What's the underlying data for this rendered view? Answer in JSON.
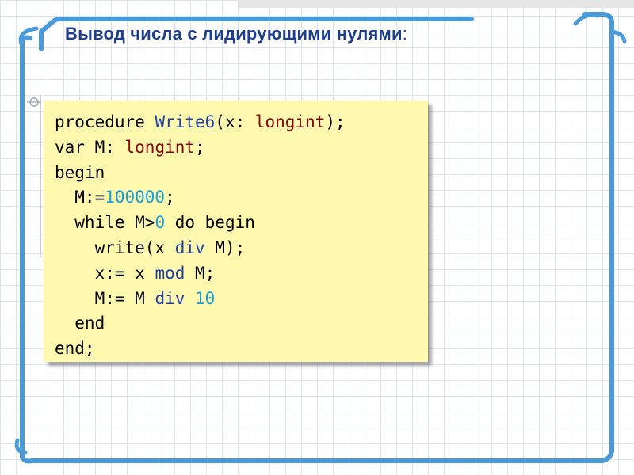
{
  "slide": {
    "title": "Вывод числа с лидирующими нулями",
    "title_colon": ":"
  },
  "code_lines": [
    [
      {
        "t": "procedure ",
        "c": "plain"
      },
      {
        "t": "Write6",
        "c": "blue"
      },
      {
        "t": "(x: ",
        "c": "plain"
      },
      {
        "t": "longint",
        "c": "red"
      },
      {
        "t": ");",
        "c": "plain"
      }
    ],
    [
      {
        "t": "var M: ",
        "c": "plain"
      },
      {
        "t": "longint",
        "c": "red"
      },
      {
        "t": ";",
        "c": "plain"
      }
    ],
    [
      {
        "t": "begin",
        "c": "plain"
      }
    ],
    [
      {
        "t": "  M:=",
        "c": "plain"
      },
      {
        "t": "100000",
        "c": "num"
      },
      {
        "t": ";",
        "c": "plain"
      }
    ],
    [
      {
        "t": "  while M>",
        "c": "plain"
      },
      {
        "t": "0",
        "c": "num"
      },
      {
        "t": " do begin",
        "c": "plain"
      }
    ],
    [
      {
        "t": "    write(x ",
        "c": "plain"
      },
      {
        "t": "div",
        "c": "blue"
      },
      {
        "t": " M);",
        "c": "plain"
      }
    ],
    [
      {
        "t": "    x:= x ",
        "c": "plain"
      },
      {
        "t": "mod",
        "c": "blue"
      },
      {
        "t": " M;",
        "c": "plain"
      }
    ],
    [
      {
        "t": "    M:= M ",
        "c": "plain"
      },
      {
        "t": "div",
        "c": "blue"
      },
      {
        "t": " ",
        "c": "plain"
      },
      {
        "t": "10",
        "c": "num"
      }
    ],
    [
      {
        "t": "  end",
        "c": "plain"
      }
    ],
    [
      {
        "t": "end;",
        "c": "plain"
      }
    ]
  ],
  "colors": {
    "frame": "#4a9ad8",
    "title": "#1c3e8c",
    "code_bg": "#fff9b0",
    "keyword_red": "#8b0000",
    "keyword_blue": "#1f3fa8",
    "number": "#1aa0d8"
  }
}
